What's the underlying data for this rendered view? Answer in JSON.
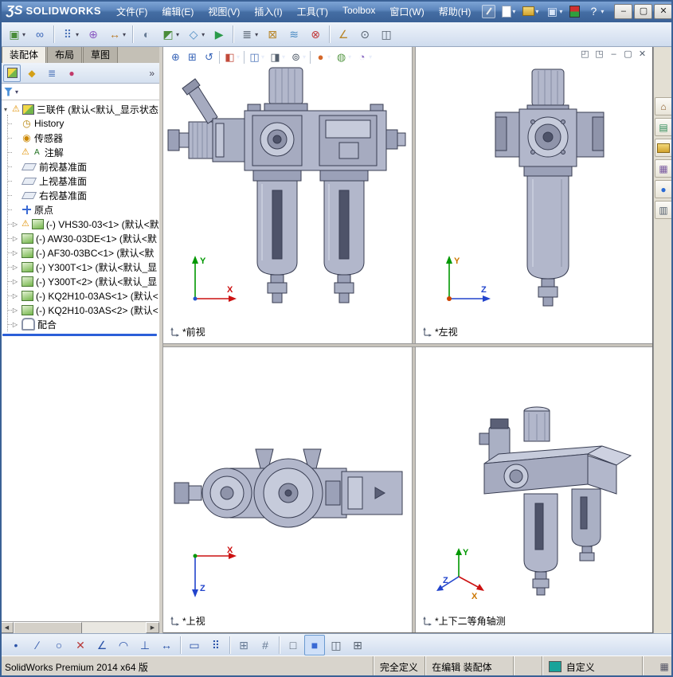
{
  "window": {
    "logo_mark": "ƷS",
    "logo_text": "SOLIDWORKS"
  },
  "menubar": {
    "items": [
      {
        "name": "file",
        "label": "文件(F)"
      },
      {
        "name": "edit",
        "label": "编辑(E)"
      },
      {
        "name": "view",
        "label": "视图(V)"
      },
      {
        "name": "insert",
        "label": "插入(I)"
      },
      {
        "name": "tools",
        "label": "工具(T)"
      },
      {
        "name": "toolbox",
        "label": "Toolbox"
      },
      {
        "name": "window",
        "label": "窗口(W)"
      },
      {
        "name": "help",
        "label": "帮助(H)"
      }
    ]
  },
  "quick_access": [
    {
      "name": "new-document",
      "caret": true
    },
    {
      "name": "open-document",
      "caret": true
    },
    {
      "name": "save-document",
      "caret": true
    },
    {
      "name": "options",
      "caret": false
    },
    {
      "name": "help-question",
      "caret": true
    }
  ],
  "window_controls": [
    {
      "name": "minimize"
    },
    {
      "name": "maximize"
    },
    {
      "name": "close"
    }
  ],
  "assembly_toolbar": [
    {
      "name": "insert-component",
      "caret": true
    },
    {
      "name": "mate"
    },
    {
      "sep": true
    },
    {
      "name": "linear-component-pattern",
      "caret": true
    },
    {
      "name": "smart-fasteners"
    },
    {
      "name": "move-component",
      "caret": true
    },
    {
      "sep": true
    },
    {
      "name": "show-hidden-components"
    },
    {
      "name": "assembly-features",
      "caret": true
    },
    {
      "name": "reference-geometry",
      "caret": true
    },
    {
      "name": "new-motion-study"
    },
    {
      "sep": true
    },
    {
      "name": "bill-of-materials",
      "caret": true
    },
    {
      "name": "exploded-view"
    },
    {
      "name": "explode-line-sketch"
    },
    {
      "name": "interference-detection"
    },
    {
      "sep": true
    },
    {
      "name": "measure"
    },
    {
      "name": "mass-properties"
    },
    {
      "name": "section-properties"
    }
  ],
  "left_panel": {
    "tabs": [
      {
        "name": "assembly",
        "label": "装配体",
        "active": true
      },
      {
        "name": "layout",
        "label": "布局",
        "active": false
      },
      {
        "name": "sketch",
        "label": "草图",
        "active": false
      }
    ],
    "pane_tabs": [
      {
        "name": "featuremanager-tree"
      },
      {
        "name": "propertymanager"
      },
      {
        "name": "configurationmanager"
      },
      {
        "name": "displaymanager"
      }
    ],
    "overflow_label": "»",
    "tree_items": [
      {
        "name": "root-assembly",
        "label": "三联件 (默认<默认_显示状态",
        "icon": "assembly",
        "warning": true,
        "expand": "open",
        "level": 0
      },
      {
        "name": "history",
        "label": "History",
        "icon": "history",
        "level": 1
      },
      {
        "name": "sensors",
        "label": "传感器",
        "icon": "sensors",
        "level": 1
      },
      {
        "name": "annotations",
        "label": "注解",
        "icon": "annotations",
        "warning": true,
        "level": 1
      },
      {
        "name": "front-plane",
        "label": "前视基准面",
        "icon": "plane",
        "level": 1
      },
      {
        "name": "top-plane",
        "label": "上视基准面",
        "icon": "plane",
        "level": 1
      },
      {
        "name": "right-plane",
        "label": "右视基准面",
        "icon": "plane",
        "level": 1
      },
      {
        "name": "origin",
        "label": "原点",
        "icon": "origin",
        "level": 1
      },
      {
        "name": "component-vhs30-03-1",
        "label": "(-) VHS30-03<1> (默认<默",
        "icon": "part",
        "warning": true,
        "expand": "closed",
        "level": 1
      },
      {
        "name": "component-aw30-03de-1",
        "label": "(-) AW30-03DE<1> (默认<默",
        "icon": "part",
        "expand": "closed",
        "level": 1
      },
      {
        "name": "component-af30-03bc-1",
        "label": "(-) AF30-03BC<1> (默认<默",
        "icon": "part",
        "expand": "closed",
        "level": 1
      },
      {
        "name": "component-y300t-1",
        "label": "(-) Y300T<1> (默认<默认_显",
        "icon": "part",
        "expand": "closed",
        "level": 1
      },
      {
        "name": "component-y300t-2",
        "label": "(-) Y300T<2> (默认<默认_显",
        "icon": "part",
        "expand": "closed",
        "level": 1
      },
      {
        "name": "component-kq2h10-03as-1",
        "label": "(-) KQ2H10-03AS<1> (默认<",
        "icon": "part",
        "expand": "closed",
        "level": 1
      },
      {
        "name": "component-kq2h10-03as-2",
        "label": "(-) KQ2H10-03AS<2> (默认<",
        "icon": "part",
        "expand": "closed",
        "level": 1
      },
      {
        "name": "mates",
        "label": "配合",
        "icon": "mates",
        "expand": "closed",
        "level": 1
      }
    ]
  },
  "viewport_toolbar": [
    {
      "name": "zoom-to-fit"
    },
    {
      "name": "zoom-to-area"
    },
    {
      "name": "previous-view"
    },
    {
      "sep": true
    },
    {
      "name": "section-view",
      "caret": true
    },
    {
      "sep": true
    },
    {
      "name": "view-orientation",
      "caret": true
    },
    {
      "name": "display-style",
      "caret": true
    },
    {
      "name": "hide-show-items",
      "caret": true
    },
    {
      "sep": true
    },
    {
      "name": "edit-appearance",
      "caret": true
    },
    {
      "name": "apply-scene",
      "caret": true
    },
    {
      "name": "view-settings",
      "caret": true
    }
  ],
  "doc_controls": [
    {
      "name": "doc-tile-left"
    },
    {
      "name": "doc-tile-right"
    },
    {
      "name": "doc-minimize"
    },
    {
      "name": "doc-restore"
    },
    {
      "name": "doc-close"
    }
  ],
  "viewports": [
    {
      "name": "front",
      "label": "*前视"
    },
    {
      "name": "left",
      "label": "*左视"
    },
    {
      "name": "top",
      "label": "*上视"
    },
    {
      "name": "dimetric",
      "label": "*上下二等角轴测"
    }
  ],
  "task_pane": [
    {
      "name": "solidworks-resources"
    },
    {
      "name": "design-library"
    },
    {
      "name": "file-explorer"
    },
    {
      "name": "view-palette"
    },
    {
      "name": "appearances-scenes"
    },
    {
      "name": "custom-properties"
    }
  ],
  "sketch_toolbar": [
    {
      "name": "point"
    },
    {
      "name": "line"
    },
    {
      "name": "circle"
    },
    {
      "name": "trim-entities"
    },
    {
      "name": "sketch-fillet"
    },
    {
      "name": "three-point-arc"
    },
    {
      "name": "add-relation"
    },
    {
      "name": "smart-dimension"
    },
    {
      "sep": true
    },
    {
      "name": "corner-rectangle"
    },
    {
      "name": "linear-sketch-pattern"
    },
    {
      "sep": true
    },
    {
      "name": "display-grid"
    },
    {
      "name": "snap-to-points"
    },
    {
      "sep": true
    },
    {
      "name": "viewport-single"
    },
    {
      "name": "shaded-with-edges",
      "active": true
    },
    {
      "name": "viewport-two"
    },
    {
      "name": "viewport-four"
    }
  ],
  "status_bar": {
    "app_version": "SolidWorks Premium 2014 x64 版",
    "definition_state": "完全定义",
    "editing_state": "在编辑 装配体",
    "units_label": "自定义",
    "swatch_color": "#18a39a"
  }
}
